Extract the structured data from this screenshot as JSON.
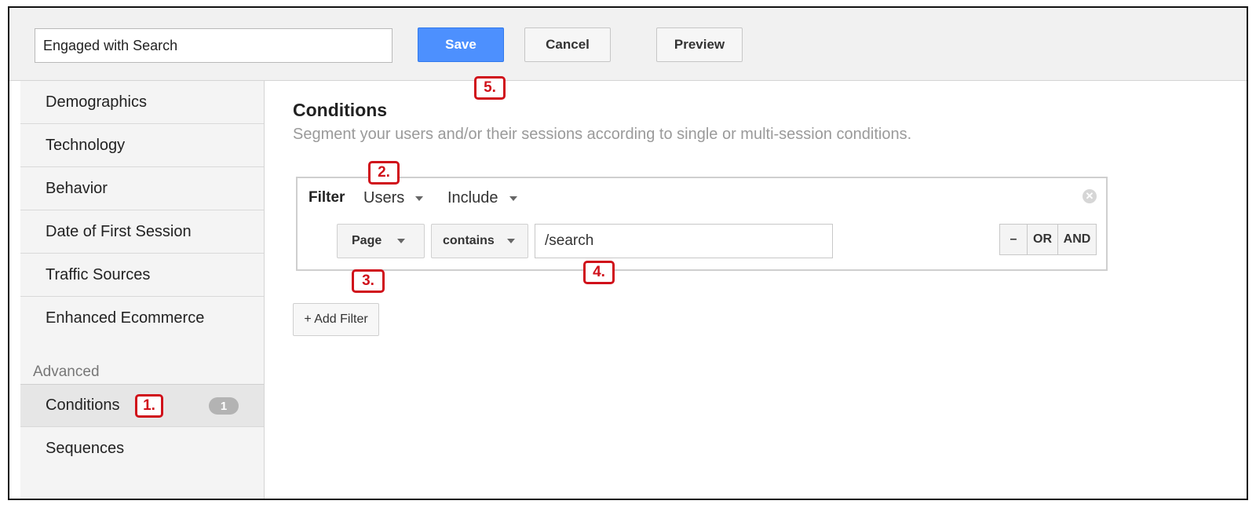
{
  "toolbar": {
    "segment_name": "Engaged with Search",
    "save_label": "Save",
    "cancel_label": "Cancel",
    "preview_label": "Preview"
  },
  "sidebar": {
    "items": [
      {
        "label": "Demographics"
      },
      {
        "label": "Technology"
      },
      {
        "label": "Behavior"
      },
      {
        "label": "Date of First Session"
      },
      {
        "label": "Traffic Sources"
      },
      {
        "label": "Enhanced Ecommerce"
      }
    ],
    "advanced_header": "Advanced",
    "advanced_items": [
      {
        "label": "Conditions",
        "badge": "1",
        "active": true
      },
      {
        "label": "Sequences"
      }
    ]
  },
  "main": {
    "title": "Conditions",
    "subtitle": "Segment your users and/or their sessions according to single or multi-session conditions.",
    "filter": {
      "label": "Filter",
      "scope": "Users",
      "mode": "Include",
      "dimension": "Page",
      "operator": "contains",
      "value": "/search",
      "remove_label": "–",
      "or_label": "OR",
      "and_label": "AND"
    },
    "add_filter_label": "+ Add Filter"
  },
  "annotations": [
    "1.",
    "2.",
    "3.",
    "4.",
    "5."
  ],
  "colors": {
    "save_blue": "#4d90fe",
    "annotation_red": "#d0101a",
    "sidebar_bg": "#f4f4f4"
  }
}
